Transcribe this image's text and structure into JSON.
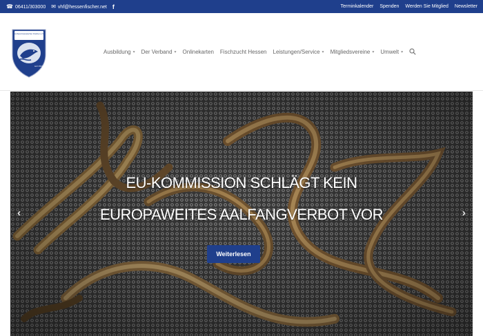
{
  "topbar": {
    "phone": "06411/303000",
    "email": "vhf@hessenfischer.net",
    "facebook_icon": "f",
    "links": [
      "Terminkalender",
      "Spenden",
      "Werden Sie Mitglied",
      "Newsletter"
    ]
  },
  "logo": {
    "text_top": "Verband Hessischer Fischer e.V.",
    "text_bottom": "seit 1913"
  },
  "nav": {
    "items": [
      {
        "label": "Ausbildung",
        "dropdown": true
      },
      {
        "label": "Der Verband",
        "dropdown": true
      },
      {
        "label": "Onlinekarten",
        "dropdown": false
      },
      {
        "label": "Fischzucht Hessen",
        "dropdown": false
      },
      {
        "label": "Leistungen/Service",
        "dropdown": true
      },
      {
        "label": "Mitgliedsvereine",
        "dropdown": true
      },
      {
        "label": "Umwelt",
        "dropdown": true
      }
    ],
    "chevron_icon": "chevron-down-icon",
    "search_icon": "search-icon"
  },
  "hero": {
    "headline_line1": "EU-KOMMISSION SCHLÄGT KEIN",
    "headline_line2": "EUROPAWEITES AALFANGVERBOT VOR",
    "button_label": "Weiterlesen",
    "prev_arrow": "‹",
    "next_arrow": "›"
  },
  "colors": {
    "brand_blue": "#1f3f8c",
    "nav_text": "#666666"
  }
}
